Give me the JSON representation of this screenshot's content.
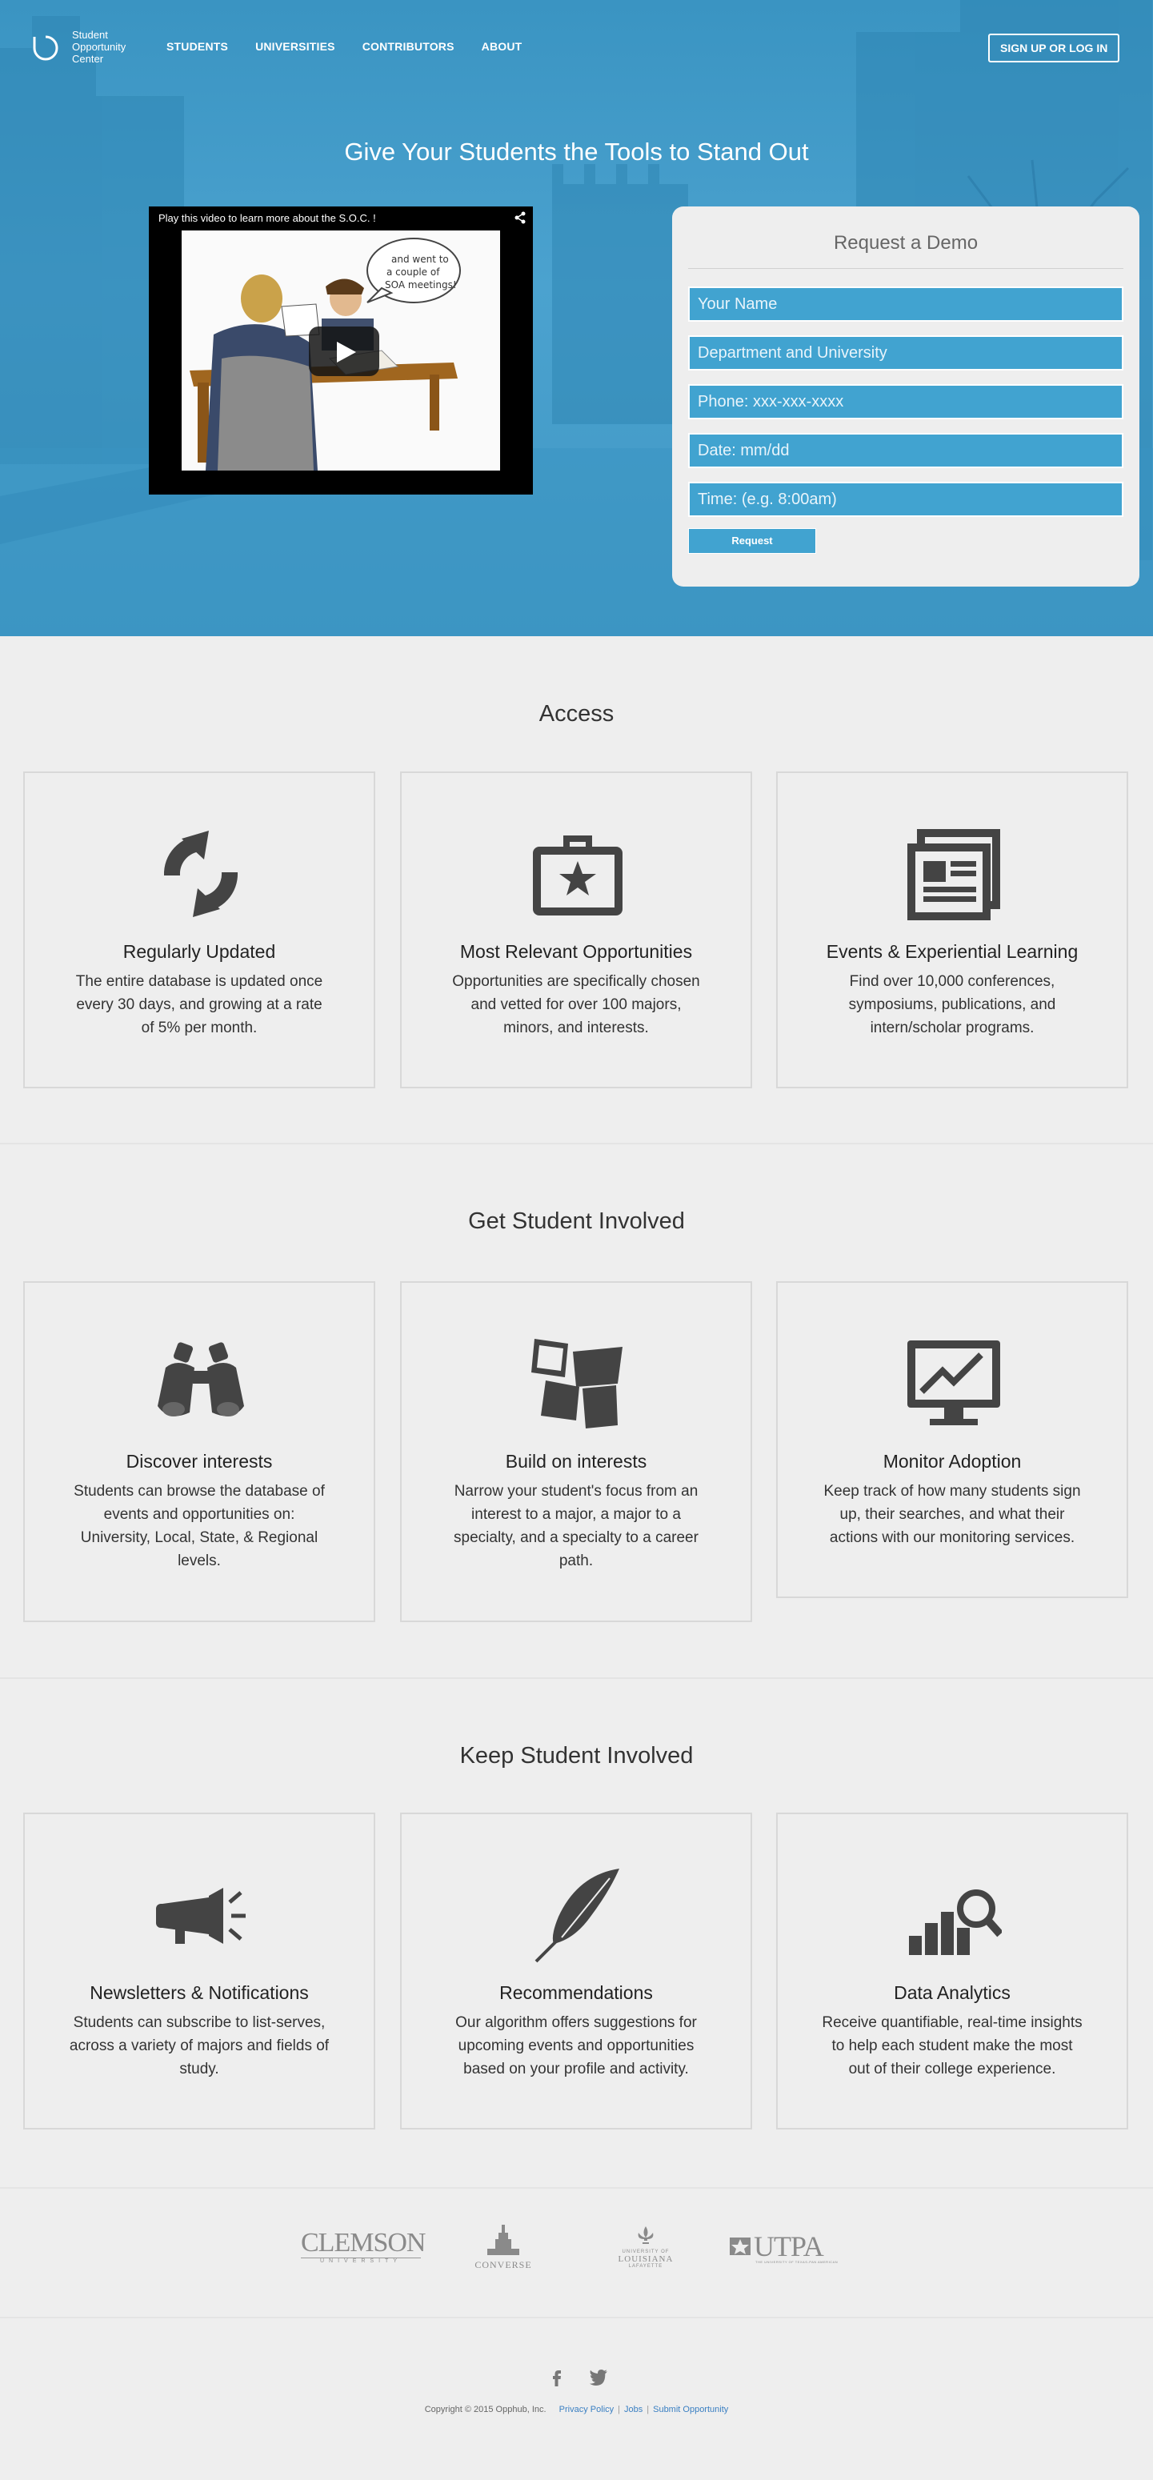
{
  "brand": {
    "name_line1": "Student",
    "name_line2": "Opportunity",
    "name_line3": "Center"
  },
  "nav": {
    "items": [
      {
        "label": "STUDENTS"
      },
      {
        "label": "UNIVERSITIES"
      },
      {
        "label": "CONTRIBUTORS"
      },
      {
        "label": "ABOUT"
      }
    ],
    "signup_label": "SIGN UP OR LOG IN"
  },
  "hero": {
    "title": "Give Your Students the Tools to Stand Out",
    "video_caption": "Play this video to learn more about the S.O.C. !",
    "video_bubble": [
      "and went to",
      "a couple of",
      "SOA meetings!"
    ]
  },
  "demo": {
    "title": "Request a Demo",
    "name_placeholder": "Your Name",
    "dept_placeholder": "Department and University",
    "phone_placeholder": "Phone: xxx-xxx-xxxx",
    "date_placeholder": "Date: mm/dd",
    "time_placeholder": "Time: (e.g. 8:00am)",
    "button_label": "Request"
  },
  "access": {
    "title": "Access",
    "cards": [
      {
        "icon": "refresh-icon",
        "title": "Regularly Updated",
        "lines": [
          "The entire database is updated once",
          "every 30 days, and growing at a rate",
          "of 5% per month."
        ]
      },
      {
        "icon": "briefcase-star-icon",
        "title": "Most Relevant Opportunities",
        "lines": [
          "Opportunities are specifically chosen",
          "and vetted for over 100 majors,",
          "minors, and interests."
        ]
      },
      {
        "icon": "newspaper-icon",
        "title": "Events & Experiential Learning",
        "lines": [
          "Find over 10,000 conferences,",
          "symposiums, publications, and",
          "intern/scholar programs."
        ]
      }
    ]
  },
  "involved": {
    "title": "Get Student Involved",
    "cards": [
      {
        "icon": "binoculars-icon",
        "title": "Discover interests",
        "lines": [
          "Students can browse the database of",
          "events and opportunities on:",
          "University, Local, State, & Regional",
          "levels."
        ]
      },
      {
        "icon": "building-blocks-icon",
        "title": "Build on interests",
        "lines": [
          "Narrow your student's focus from an",
          "interest to a major, a major to a",
          "specialty, and a specialty to a career",
          "path."
        ]
      },
      {
        "icon": "monitor-chart-icon",
        "title": "Monitor Adoption",
        "lines": [
          "Keep track of how many students sign",
          "up, their searches, and what their",
          "actions with our monitoring services."
        ]
      }
    ]
  },
  "keep": {
    "title": "Keep Student Involved",
    "cards": [
      {
        "icon": "megaphone-icon",
        "title": "Newsletters & Notifications",
        "lines": [
          "Students can subscribe to list-serves,",
          "across a variety of majors and fields of",
          "study."
        ]
      },
      {
        "icon": "quill-icon",
        "title": "Recommendations",
        "lines": [
          "Our algorithm offers suggestions for",
          "upcoming events and opportunities",
          "based on your profile and activity."
        ]
      },
      {
        "icon": "analytics-icon",
        "title": "Data Analytics",
        "lines": [
          "Receive quantifiable, real-time insights",
          "to help each student make the most",
          "out of their college experience."
        ]
      }
    ]
  },
  "universities": {
    "clemson": "CLEMSON",
    "clemson_sub": "UNIVERSITY",
    "converse": "CONVERSE",
    "louisiana_1": "UNIVERSITY OF",
    "louisiana_2": "LOUISIANA",
    "louisiana_3": "LAFAYETTE",
    "utpa": "UTPA",
    "utpa_sub": "THE UNIVERSITY OF TEXAS-PAN AMERICAN"
  },
  "footer": {
    "copyright": "Copyright © 2015 Opphub, Inc.",
    "links": [
      "Privacy Policy",
      "Jobs",
      "Submit Opportunity"
    ]
  },
  "colors": {
    "hero_blue": "#41a3d0",
    "link_blue": "#3a7fc2",
    "icon_gray": "#444444"
  }
}
